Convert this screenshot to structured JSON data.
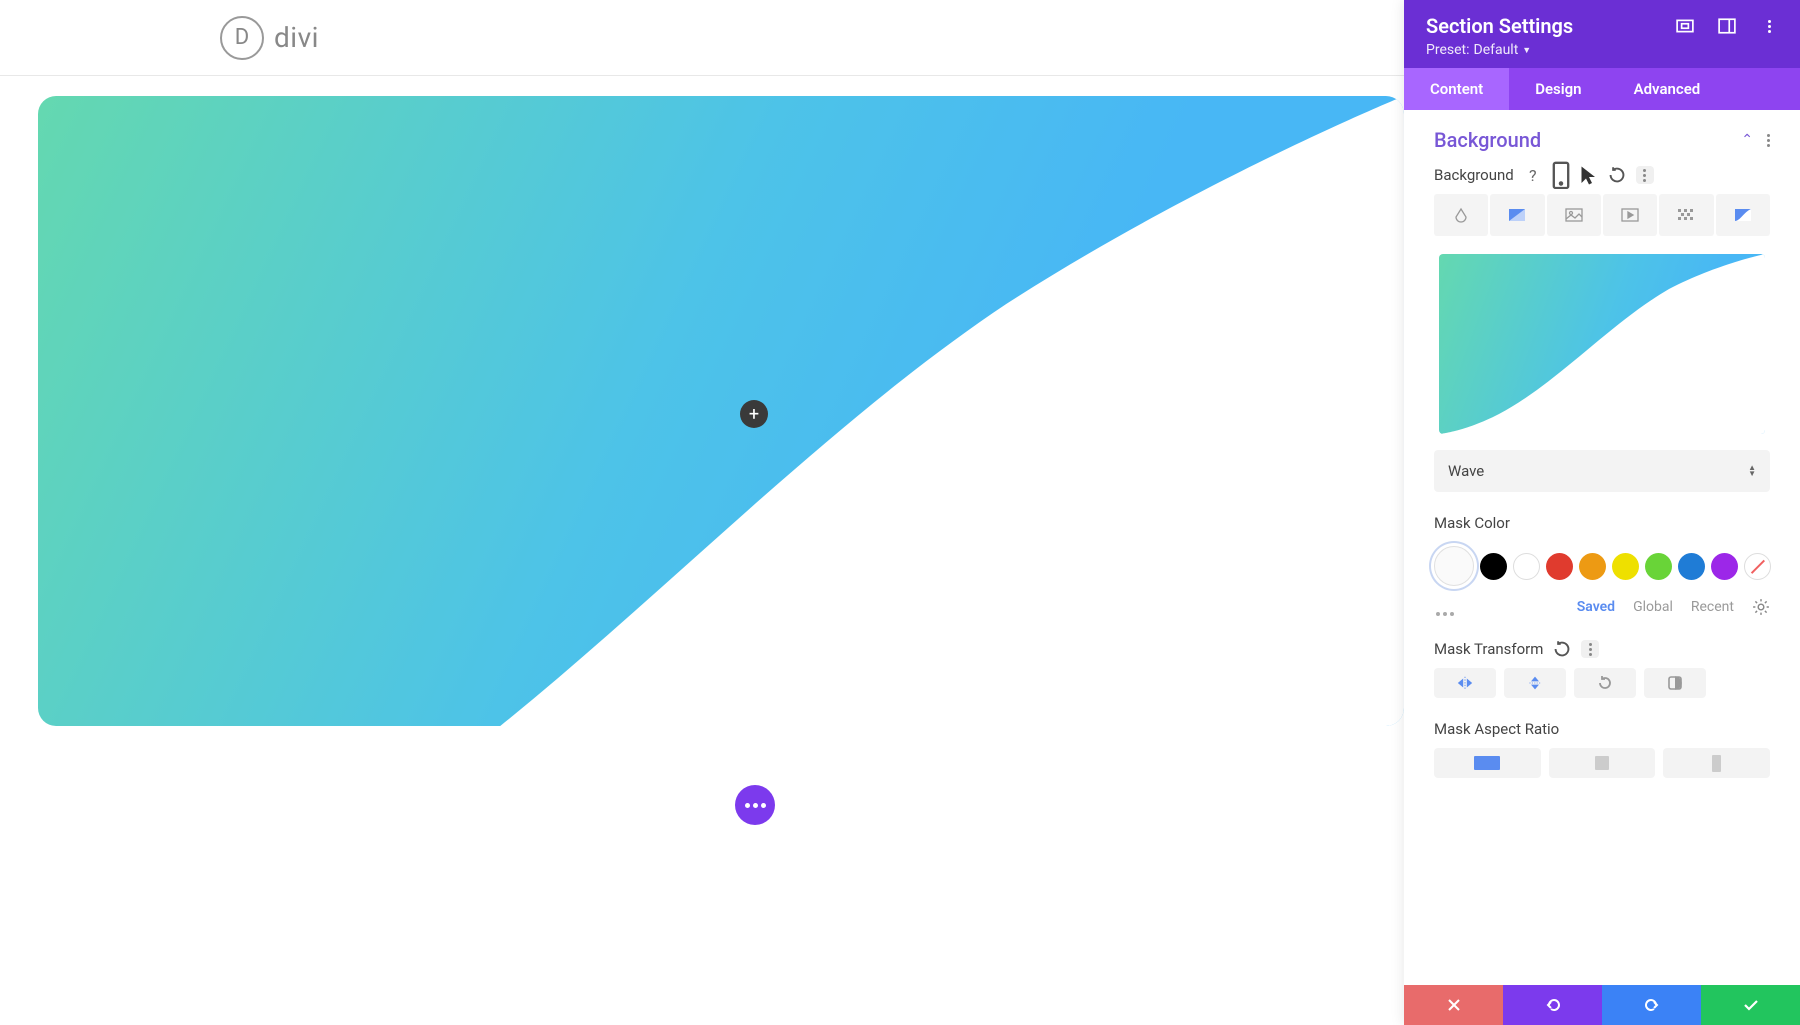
{
  "logo": {
    "letter": "D",
    "text": "divi"
  },
  "panel": {
    "title": "Section Settings",
    "preset_label": "Preset:",
    "preset_value": "Default"
  },
  "tabs": {
    "content": "Content",
    "design": "Design",
    "advanced": "Advanced"
  },
  "section": {
    "title": "Background"
  },
  "bg_label": "Background",
  "mask_select": "Wave",
  "mask_color_label": "Mask Color",
  "colors": [
    {
      "id": "selected",
      "hex": "#f5f5f5",
      "selected": true
    },
    {
      "id": "black",
      "hex": "#000000"
    },
    {
      "id": "white",
      "hex": "#ffffff",
      "border": true
    },
    {
      "id": "red",
      "hex": "#E03B2E"
    },
    {
      "id": "orange",
      "hex": "#ED9A13"
    },
    {
      "id": "yellow",
      "hex": "#EEE000"
    },
    {
      "id": "green",
      "hex": "#69D438"
    },
    {
      "id": "blue",
      "hex": "#1F7CD6"
    },
    {
      "id": "purple",
      "hex": "#9C27E8"
    },
    {
      "id": "none",
      "hex": "transparent",
      "none": true
    }
  ],
  "color_tabs": {
    "saved": "Saved",
    "global": "Global",
    "recent": "Recent"
  },
  "mask_transform_label": "Mask Transform",
  "mask_aspect_label": "Mask Aspect Ratio",
  "chart_data": {
    "type": "preview-gradient",
    "gradient": [
      "#64D8B0",
      "#4DC3E8",
      "#48B7F5"
    ],
    "mask_shape": "wave"
  }
}
